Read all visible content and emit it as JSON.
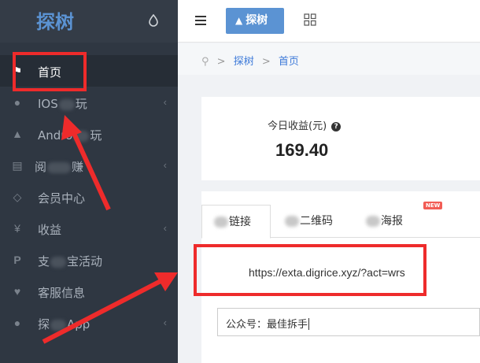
{
  "app": {
    "logo": "探树"
  },
  "sidebar": {
    "items": [
      {
        "label_parts": [
          "首页"
        ],
        "icon": "home-icon",
        "active": true,
        "has_arrow": false
      },
      {
        "label_parts": [
          "IOS",
          "",
          "玩"
        ],
        "icon": "apple-icon",
        "active": false,
        "has_arrow": true
      },
      {
        "label_parts": [
          "Andro",
          "",
          "玩"
        ],
        "icon": "android-icon",
        "active": false,
        "has_arrow": true
      },
      {
        "label_parts": [
          "阅",
          "",
          "赚"
        ],
        "icon": "book-icon",
        "active": false,
        "has_arrow": true
      },
      {
        "label_parts": [
          "会员中心"
        ],
        "icon": "diamond-icon",
        "active": false,
        "has_arrow": false
      },
      {
        "label_parts": [
          "收益"
        ],
        "icon": "yen-icon",
        "active": false,
        "has_arrow": true
      },
      {
        "label_parts": [
          "支",
          "",
          "宝活动"
        ],
        "icon": "paypal-icon",
        "active": false,
        "has_arrow": false
      },
      {
        "label_parts": [
          "客服信息"
        ],
        "icon": "heart-icon",
        "active": false,
        "has_arrow": false
      },
      {
        "label_parts": [
          "探",
          "",
          "App"
        ],
        "icon": "apple-icon",
        "active": false,
        "has_arrow": true
      }
    ]
  },
  "topbar": {
    "brand_label": "探树"
  },
  "breadcrumb": {
    "items": [
      "探树",
      "首页"
    ]
  },
  "stats": {
    "label": "今日收益(元)",
    "value": "169.40"
  },
  "tabs": [
    {
      "prefix": "推",
      "suffix": "链接",
      "active": true
    },
    {
      "prefix": "推",
      "suffix": "二维码",
      "active": false
    },
    {
      "prefix": "推",
      "suffix": "海报",
      "active": false,
      "badge": "NEW"
    }
  ],
  "invite": {
    "link": "https://exta.digrice.xyz/?act=wrs"
  },
  "account": {
    "text": "公众号：最佳拆手"
  },
  "colors": {
    "sidebar_bg": "#2f3742",
    "brand_blue": "#5b93d3",
    "link_blue": "#3d7ad9",
    "annotation_red": "#ee2b2b"
  }
}
